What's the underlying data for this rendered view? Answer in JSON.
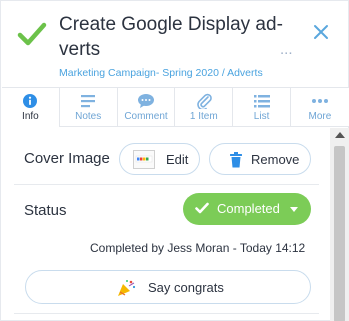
{
  "task": {
    "title": "Create Google Display ad-verts",
    "breadcrumb": "Marketing Campaign- Spring 2020 / Adverts",
    "more_label": "...",
    "status_color": "#7ccc57",
    "accent_color": "#4aa3df"
  },
  "tabs": [
    {
      "label": "Info",
      "icon": "info-icon",
      "active": true
    },
    {
      "label": "Notes",
      "icon": "notes-icon",
      "active": false
    },
    {
      "label": "Comment",
      "icon": "comment-icon",
      "active": false
    },
    {
      "label": "1 Item",
      "icon": "paperclip-icon",
      "active": false
    },
    {
      "label": "List",
      "icon": "list-icon",
      "active": false
    },
    {
      "label": "More",
      "icon": "more-icon",
      "active": false
    }
  ],
  "cover_image": {
    "label": "Cover Image",
    "edit_label": "Edit",
    "remove_label": "Remove"
  },
  "status": {
    "label": "Status",
    "value": "Completed",
    "completed_by": "Completed by Jess Moran - Today 14:12"
  },
  "congrats": {
    "label": "Say congrats"
  }
}
